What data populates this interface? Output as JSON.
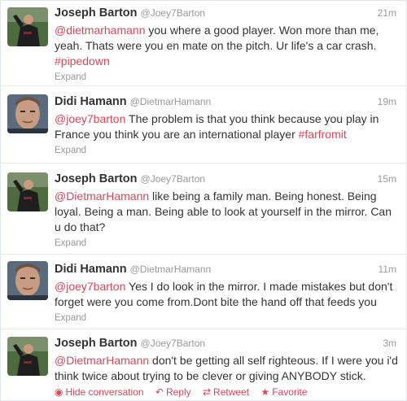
{
  "tweets": [
    {
      "fullname": "Joseph Barton",
      "username": "@Joey7Barton",
      "time": "21m",
      "mention": "@dietmarhamann",
      "text": " you where a good player. Won more than me, yeah. Thats were you en mate on the pitch. Ur life's a car crash. ",
      "hashtag": "#pipedown",
      "expand": "Expand"
    },
    {
      "fullname": "Didi Hamann",
      "username": "@DietmarHamann",
      "time": "19m",
      "mention": "@joey7barton",
      "text": " The problem is that you think because you play in France you think you are an international player ",
      "hashtag": "#farfromit",
      "expand": "Expand"
    },
    {
      "fullname": "Joseph Barton",
      "username": "@Joey7Barton",
      "time": "15m",
      "mention": "@DietmarHamann",
      "text": " like being a family man. Being honest. Being loyal. Being a man. Being able to look at yourself in the mirror. Can u do that?",
      "expand": "Expand"
    },
    {
      "fullname": "Didi Hamann",
      "username": "@DietmarHamann",
      "time": "11m",
      "mention": "@joey7barton",
      "text": " Yes I do look in the mirror. I made mistakes but don't forget were you come from.Dont bite the hand off that feeds you",
      "expand": "Expand"
    },
    {
      "fullname": "Joseph Barton",
      "username": "@Joey7Barton",
      "time": "3m",
      "mention": "@DietmarHamann",
      "text": " don't be getting all self righteous. If I were you i'd think twice about trying to be clever or giving ANYBODY stick.",
      "actions": {
        "hide_conversation": "Hide conversation",
        "reply": "Reply",
        "retweet": "Retweet",
        "favorite": "Favorite"
      }
    }
  ],
  "colors": {
    "link": "#d14a5a",
    "muted": "#999999",
    "text": "#333333"
  }
}
